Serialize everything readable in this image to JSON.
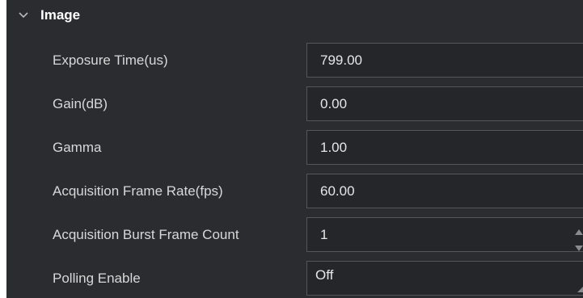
{
  "section": {
    "title": "Image",
    "expanded": true,
    "chevron_icon": "chevron-down-icon"
  },
  "params": [
    {
      "label": "Exposure Time(us)",
      "value": "799.00",
      "type": "input"
    },
    {
      "label": "Gain(dB)",
      "value": "0.00",
      "type": "input"
    },
    {
      "label": "Gamma",
      "value": "1.00",
      "type": "input"
    },
    {
      "label": "Acquisition Frame Rate(fps)",
      "value": "60.00",
      "type": "input"
    },
    {
      "label": "Acquisition Burst Frame Count",
      "value": "1",
      "type": "spinbox",
      "stepper_icons": [
        "arrow-up-icon",
        "arrow-down-icon"
      ]
    },
    {
      "label": "Polling Enable",
      "value": "Off",
      "type": "select"
    }
  ],
  "colors": {
    "panel_bg": "#2b2c30",
    "field_bg": "#25262a",
    "field_border": "#55565a",
    "label_text": "#d8d8d8",
    "header_text": "#ffffff"
  }
}
